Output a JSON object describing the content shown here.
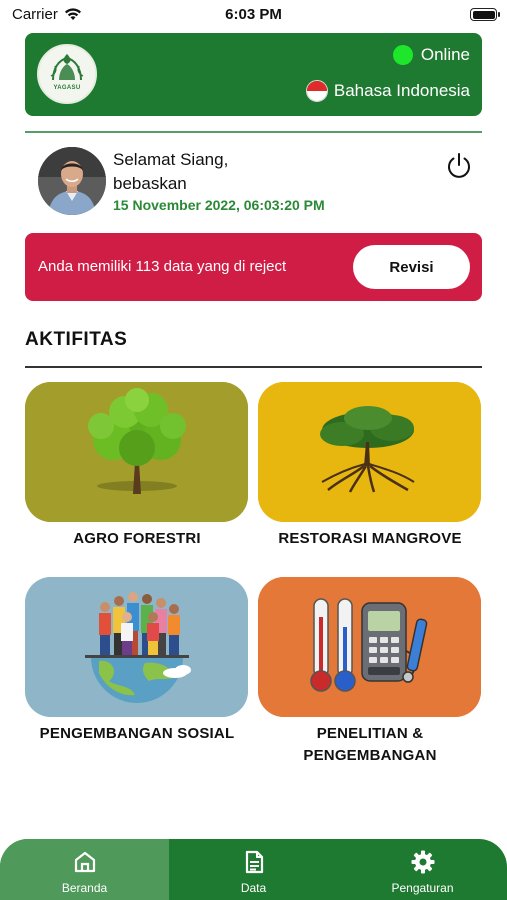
{
  "status_bar": {
    "carrier": "Carrier",
    "time": "6:03 PM"
  },
  "header": {
    "logo_text": "YAGASU",
    "connection_status": "Online",
    "language": "Bahasa Indonesia",
    "status_color": "#1ee62a",
    "brand_color": "#1f7a31"
  },
  "user": {
    "greeting": "Selamat Siang,",
    "name": "bebaskan",
    "datetime": "15 November 2022, 06:03:20 PM"
  },
  "reject_banner": {
    "message": "Anda memiliki 113 data yang di reject",
    "button_label": "Revisi",
    "color": "#cf1d45"
  },
  "activities": {
    "title": "AKTIFITAS",
    "items": [
      {
        "label": "AGRO FORESTRI",
        "icon": "tree-icon",
        "bg": "#a39e2b"
      },
      {
        "label": "RESTORASI MANGROVE",
        "icon": "mangrove-icon",
        "bg": "#e7b70f"
      },
      {
        "label": "PENGEMBANGAN SOSIAL",
        "icon": "community-globe-icon",
        "bg": "#8fb6c8"
      },
      {
        "label": "PENELITIAN & PENGEMBANGAN",
        "icon": "research-instruments-icon",
        "bg": "#e37838"
      }
    ]
  },
  "bottom_nav": {
    "items": [
      {
        "label": "Beranda",
        "icon": "home-icon",
        "active": true
      },
      {
        "label": "Data",
        "icon": "document-icon",
        "active": false
      },
      {
        "label": "Pengaturan",
        "icon": "gear-icon",
        "active": false
      }
    ]
  }
}
